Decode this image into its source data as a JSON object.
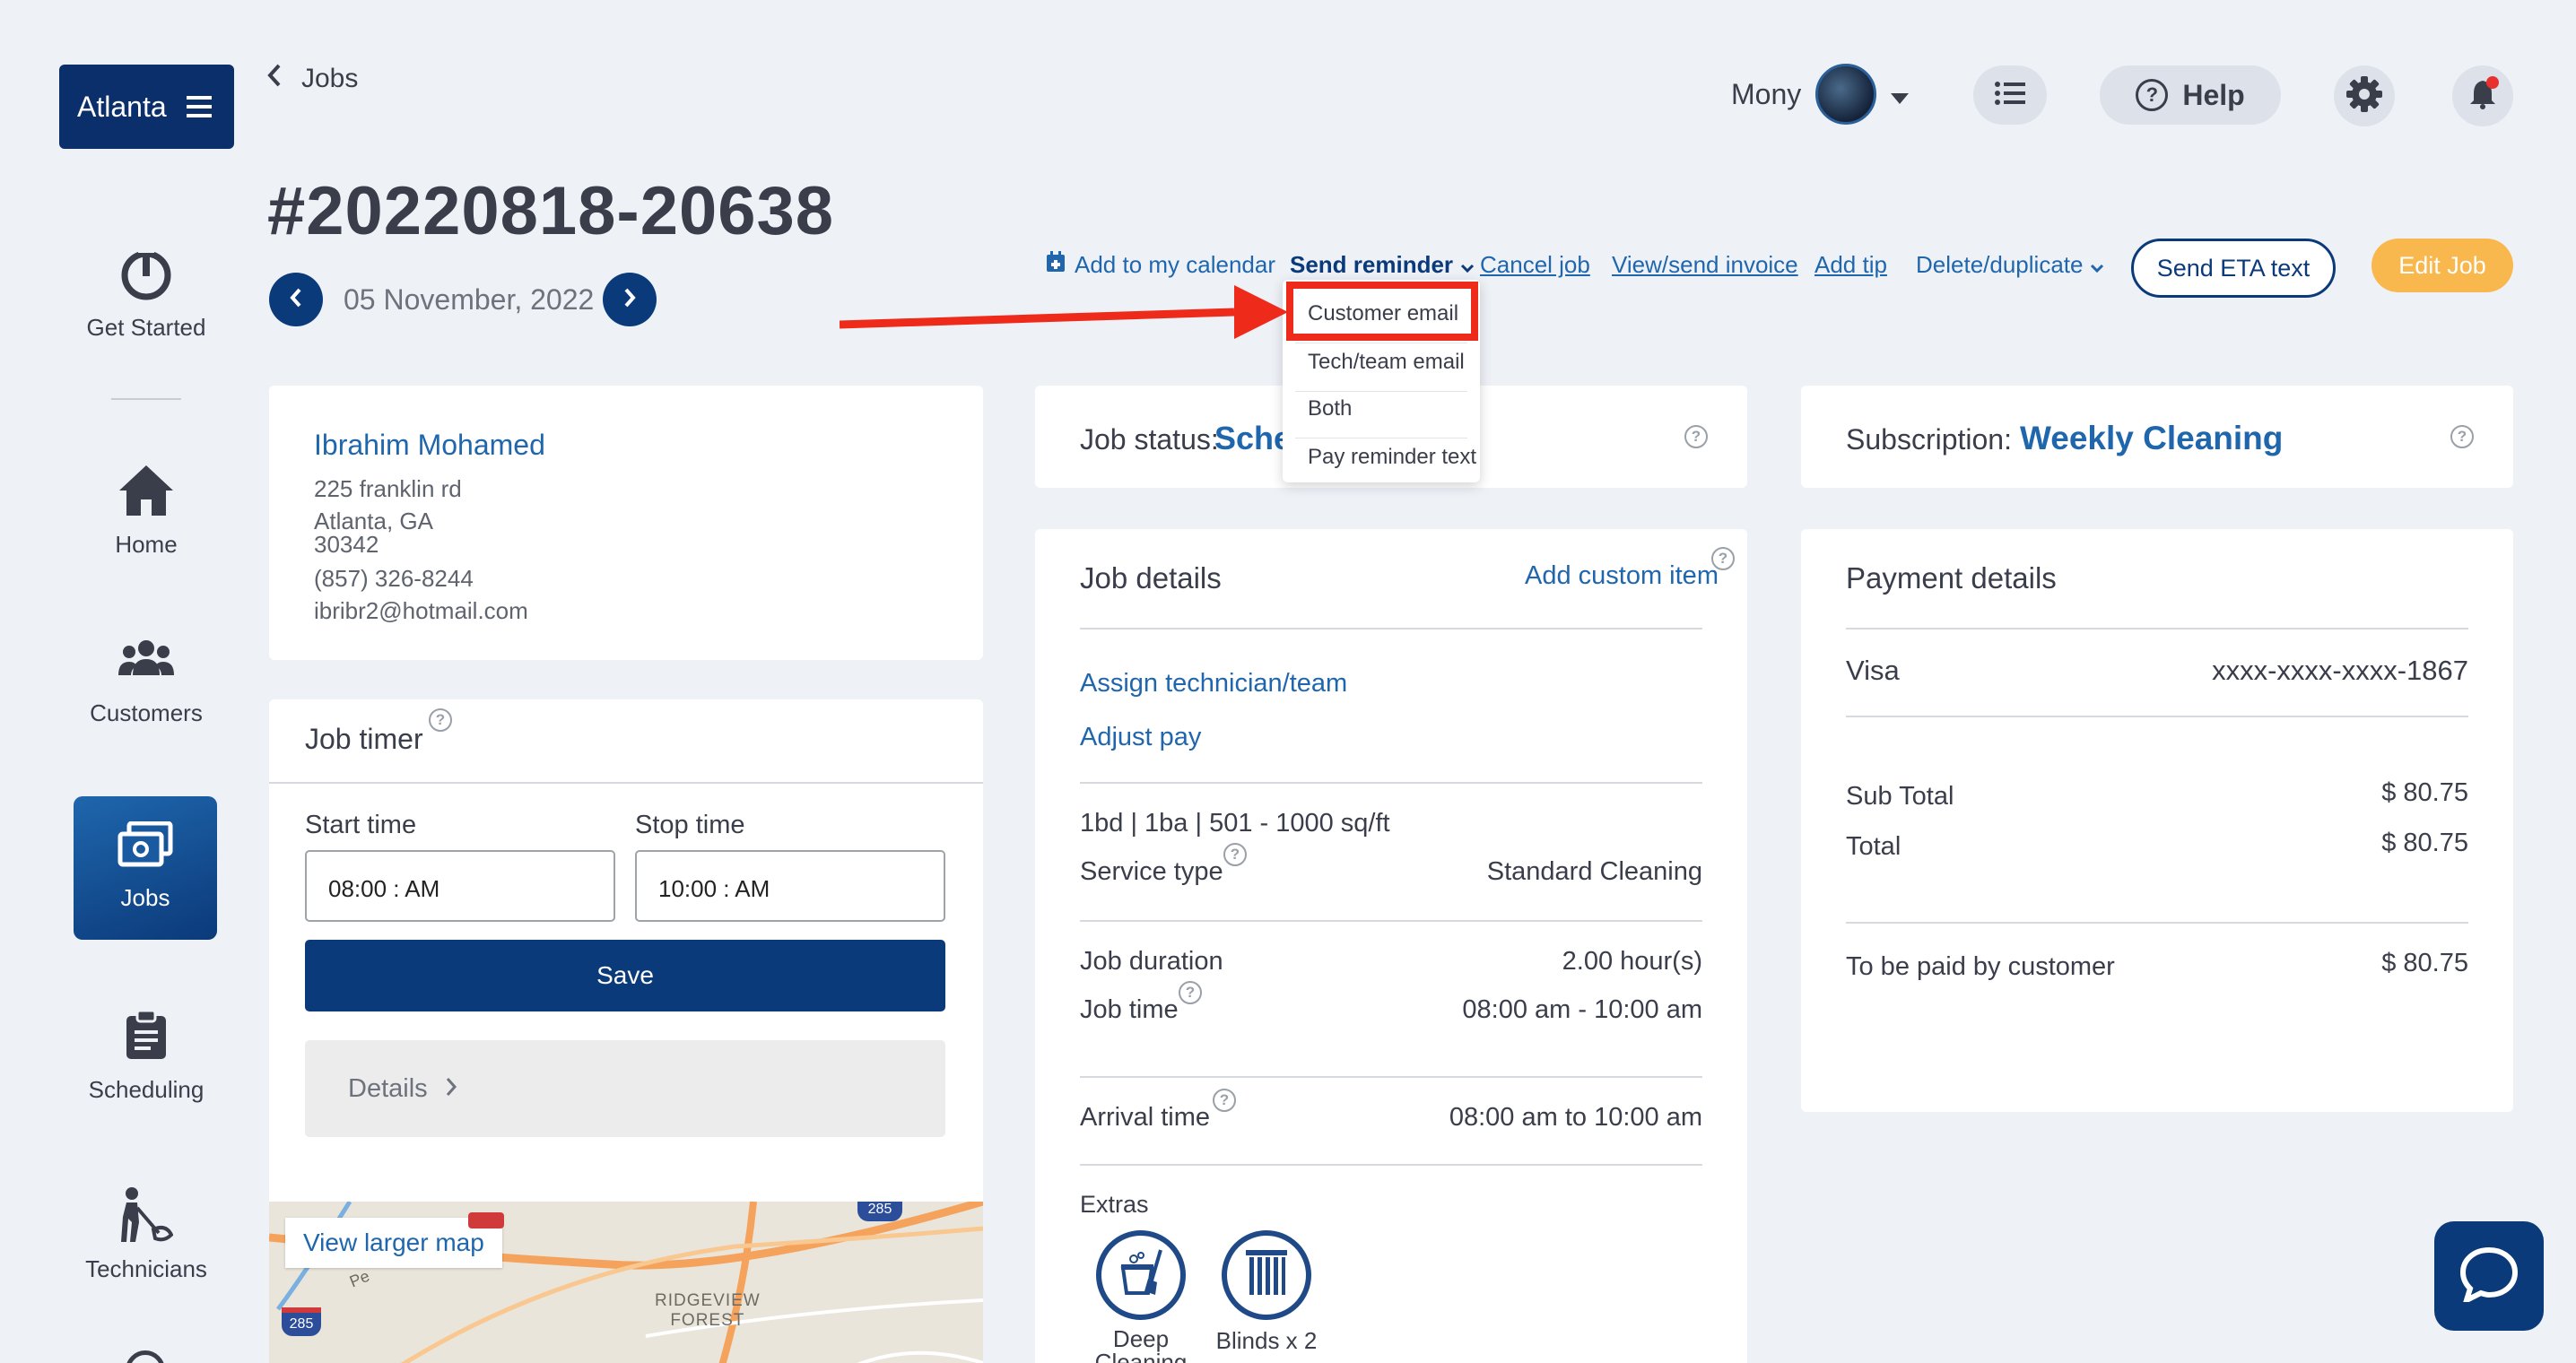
{
  "brand": {
    "label": "Atlanta"
  },
  "breadcrumb": {
    "back_label": "Jobs"
  },
  "user": {
    "name": "Mony"
  },
  "help": {
    "label": "Help"
  },
  "job": {
    "number": "#20220818-20638",
    "date": "05 November, 2022"
  },
  "sidebar": {
    "items": [
      {
        "label": "Get Started",
        "icon": "power-icon"
      },
      {
        "label": "Home",
        "icon": "home-icon"
      },
      {
        "label": "Customers",
        "icon": "users-icon"
      },
      {
        "label": "Jobs",
        "icon": "jobs-icon",
        "active": true
      },
      {
        "label": "Scheduling",
        "icon": "clipboard-icon"
      },
      {
        "label": "Technicians",
        "icon": "technician-icon"
      }
    ]
  },
  "actions": {
    "calendar": "Add to my calendar",
    "send_reminder": "Send reminder",
    "cancel_job": "Cancel job",
    "invoice": "View/send invoice",
    "add_tip": "Add tip",
    "delete_duplicate": "Delete/duplicate",
    "send_eta": "Send ETA text",
    "edit_job": "Edit Job"
  },
  "reminder_menu": {
    "items": [
      "Customer email",
      "Tech/team email",
      "Both",
      "Pay reminder text"
    ]
  },
  "customer": {
    "name": "Ibrahim Mohamed",
    "address1": "225 franklin rd",
    "address2": "Atlanta, GA",
    "zip": "30342",
    "phone": "(857) 326-8244",
    "email": "ibribr2@hotmail.com"
  },
  "timer": {
    "title": "Job timer",
    "start_label": "Start time",
    "start_value": "08:00 : AM",
    "stop_label": "Stop time",
    "stop_value": "10:00 : AM",
    "save": "Save",
    "details": "Details"
  },
  "map": {
    "link": "View larger map",
    "place": "RIDGEVIEW\nFOREST",
    "shield1": "285",
    "shield2": "285",
    "road": "Pe"
  },
  "status": {
    "label": "Job status:",
    "value": "Sche"
  },
  "subscription": {
    "label": "Subscription:",
    "value": "Weekly Cleaning"
  },
  "job_details": {
    "title": "Job details",
    "add_custom": "Add custom item",
    "assign": "Assign technician/team",
    "adjust_pay": "Adjust pay",
    "size": "1bd | 1ba | 501 - 1000 sq/ft",
    "service_type_label": "Service type",
    "service_type_value": "Standard Cleaning",
    "duration_label": "Job duration",
    "duration_value": "2.00 hour(s)",
    "job_time_label": "Job time",
    "job_time_value": "08:00 am - 10:00 am",
    "arrival_label": "Arrival time",
    "arrival_value": "08:00 am to 10:00 am",
    "extras_label": "Extras",
    "extras": [
      {
        "label": "Deep\nCleaning"
      },
      {
        "label": "Blinds x 2"
      }
    ]
  },
  "payment": {
    "title": "Payment details",
    "card_brand": "Visa",
    "card_number": "xxxx-xxxx-xxxx-1867",
    "subtotal_label": "Sub Total",
    "subtotal_value": "$ 80.75",
    "total_label": "Total",
    "total_value": "$ 80.75",
    "paid_by_label": "To be paid by customer",
    "paid_by_value": "$ 80.75"
  },
  "colors": {
    "navy": "#0b3a7a",
    "accent_blue": "#1f66ad",
    "orange": "#f8b84e",
    "red_annotation": "#ee2a1b"
  }
}
